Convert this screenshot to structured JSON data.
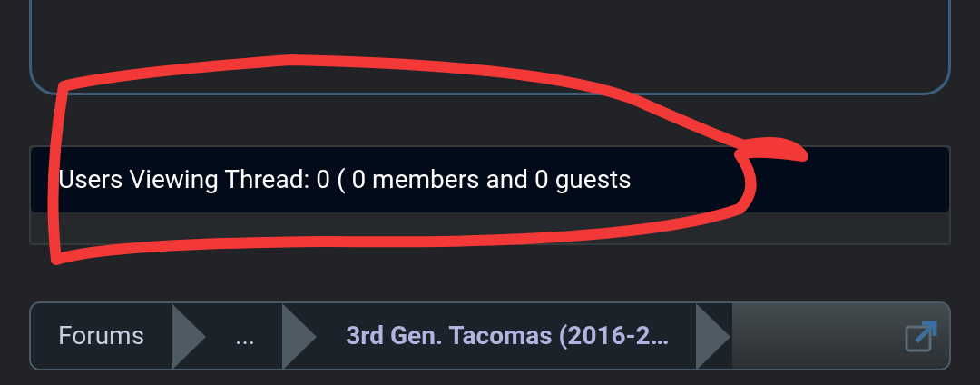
{
  "viewers_panel": {
    "text": "Users Viewing Thread: 0 ( 0 members and 0 guests"
  },
  "breadcrumb": {
    "items": [
      {
        "label": "Forums",
        "current": false
      },
      {
        "label": "...",
        "current": false
      },
      {
        "label": "3rd Gen. Tacomas (2016-2…",
        "current": true
      }
    ]
  }
}
